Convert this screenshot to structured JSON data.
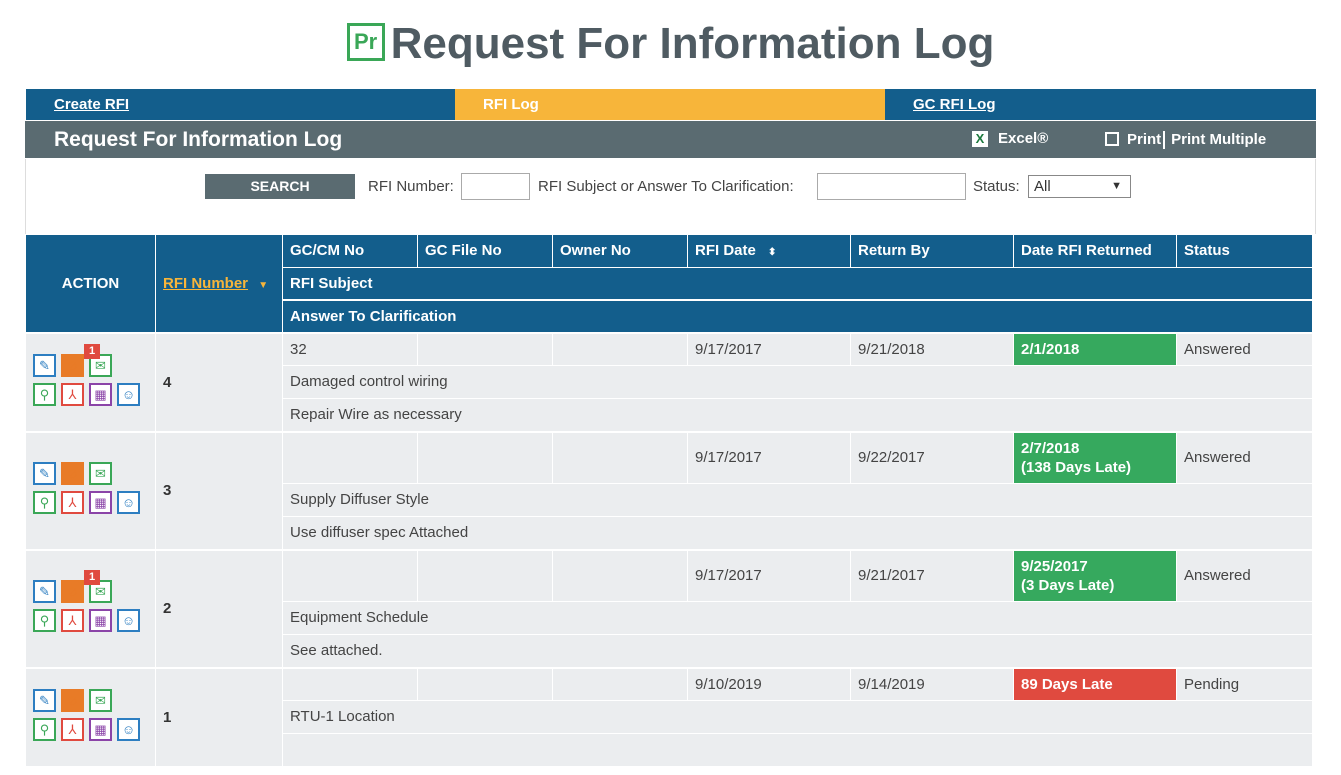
{
  "page": {
    "title": "Request For Information Log",
    "logo_text": "Pr"
  },
  "tabs": [
    {
      "label": "Create RFI"
    },
    {
      "label": "RFI Log"
    },
    {
      "label": "GC RFI Log"
    }
  ],
  "header": {
    "title": "Request For Information Log",
    "excel_label": "Excel®",
    "print_label": "Print",
    "print_multiple_label": "Print Multiple"
  },
  "search": {
    "button_label": "SEARCH",
    "rfi_number_label": "RFI Number:",
    "rfi_number_value": "",
    "subject_label": "RFI Subject or Answer To Clarification:",
    "subject_value": "",
    "status_label": "Status:",
    "status_value": "All"
  },
  "columns": {
    "action": "ACTION",
    "rfi_number": "RFI Number",
    "gc_cm_no": "GC/CM No",
    "gc_file_no": "GC File No",
    "owner_no": "Owner No",
    "rfi_date": "RFI Date",
    "return_by": "Return By",
    "date_returned": "Date RFI Returned",
    "status": "Status",
    "subject": "RFI Subject",
    "answer": "Answer To Clarification"
  },
  "rows": [
    {
      "rfi_number": "4",
      "gc_cm_no": "32",
      "gc_file_no": "",
      "owner_no": "",
      "rfi_date": "9/17/2017",
      "return_by": "9/21/2018",
      "date_returned": "2/1/2018",
      "date_returned_line2": "",
      "returned_state": "green",
      "status": "Answered",
      "subject": "Damaged control wiring",
      "answer": "Repair Wire as necessary",
      "attachment_count": "1"
    },
    {
      "rfi_number": "3",
      "gc_cm_no": "",
      "gc_file_no": "",
      "owner_no": "",
      "rfi_date": "9/17/2017",
      "return_by": "9/22/2017",
      "date_returned": "2/7/2018",
      "date_returned_line2": "(138 Days Late)",
      "returned_state": "green",
      "status": "Answered",
      "subject": "Supply Diffuser Style",
      "answer": "Use diffuser spec Attached",
      "attachment_count": ""
    },
    {
      "rfi_number": "2",
      "gc_cm_no": "",
      "gc_file_no": "",
      "owner_no": "",
      "rfi_date": "9/17/2017",
      "return_by": "9/21/2017",
      "date_returned": "9/25/2017",
      "date_returned_line2": "(3 Days Late)",
      "returned_state": "green",
      "status": "Answered",
      "subject": "Equipment Schedule",
      "answer": "See attached.",
      "attachment_count": "1"
    },
    {
      "rfi_number": "1",
      "gc_cm_no": "",
      "gc_file_no": "",
      "owner_no": "",
      "rfi_date": "9/10/2019",
      "return_by": "9/14/2019",
      "date_returned": "89 Days Late",
      "date_returned_line2": "",
      "returned_state": "red",
      "status": "Pending",
      "subject": "RTU-1 Location",
      "answer": "",
      "attachment_count": ""
    }
  ],
  "icons": [
    "pencil-icon",
    "paperclip-icon",
    "envelope-icon",
    "magnifier-icon",
    "pdf-icon",
    "calendar-icon",
    "user-icon"
  ],
  "colors": {
    "tab_blue": "#135e8c",
    "tab_active": "#f7b53a",
    "header_gray": "#5a6b71",
    "green": "#36a95e",
    "red": "#e04a3f"
  }
}
